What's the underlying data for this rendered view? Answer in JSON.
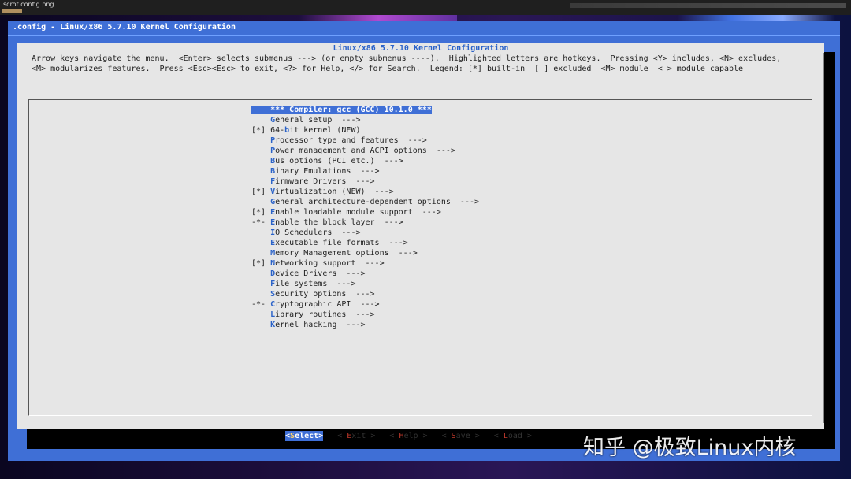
{
  "topbar": {
    "filename": "scrot config.png"
  },
  "window": {
    "title": ".config - Linux/x86 5.7.10 Kernel Configuration"
  },
  "dialog": {
    "title": "Linux/x86 5.7.10 Kernel Configuration",
    "help_line1": "Arrow keys navigate the menu.  <Enter> selects submenus ---> (or empty submenus ----).  Highlighted letters are hotkeys.  Pressing <Y> includes, <N> excludes,",
    "help_line2": "<M> modularizes features.  Press <Esc><Esc> to exit, <?> for Help, </> for Search.  Legend: [*] built-in  [ ] excluded  <M> module  < > module capable"
  },
  "menu": {
    "items": [
      {
        "prefix": "    ",
        "before": "",
        "hot": "",
        "after": "*** Compiler: gcc (GCC) 10.1.0 ***",
        "selected": true
      },
      {
        "prefix": "    ",
        "before": "",
        "hot": "G",
        "after": "eneral setup  --->"
      },
      {
        "prefix": "[*] ",
        "before": "64-",
        "hot": "b",
        "after": "it kernel (NEW)"
      },
      {
        "prefix": "    ",
        "before": "",
        "hot": "P",
        "after": "rocessor type and features  --->"
      },
      {
        "prefix": "    ",
        "before": "",
        "hot": "P",
        "after": "ower management and ACPI options  --->"
      },
      {
        "prefix": "    ",
        "before": "",
        "hot": "B",
        "after": "us options (PCI etc.)  --->"
      },
      {
        "prefix": "    ",
        "before": "",
        "hot": "B",
        "after": "inary Emulations  --->"
      },
      {
        "prefix": "    ",
        "before": "",
        "hot": "F",
        "after": "irmware Drivers  --->"
      },
      {
        "prefix": "[*] ",
        "before": "",
        "hot": "V",
        "after": "irtualization (NEW)  --->"
      },
      {
        "prefix": "    ",
        "before": "",
        "hot": "G",
        "after": "eneral architecture-dependent options  --->"
      },
      {
        "prefix": "[*] ",
        "before": "",
        "hot": "E",
        "after": "nable loadable module support  --->"
      },
      {
        "prefix": "-*- ",
        "before": "",
        "hot": "E",
        "after": "nable the block layer  --->"
      },
      {
        "prefix": "    ",
        "before": "",
        "hot": "I",
        "after": "O Schedulers  --->"
      },
      {
        "prefix": "    ",
        "before": "",
        "hot": "E",
        "after": "xecutable file formats  --->"
      },
      {
        "prefix": "    ",
        "before": "",
        "hot": "M",
        "after": "emory Management options  --->"
      },
      {
        "prefix": "[*] ",
        "before": "",
        "hot": "N",
        "after": "etworking support  --->"
      },
      {
        "prefix": "    ",
        "before": "",
        "hot": "D",
        "after": "evice Drivers  --->"
      },
      {
        "prefix": "    ",
        "before": "",
        "hot": "F",
        "after": "ile systems  --->"
      },
      {
        "prefix": "    ",
        "before": "",
        "hot": "S",
        "after": "ecurity options  --->"
      },
      {
        "prefix": "-*- ",
        "before": "",
        "hot": "C",
        "after": "ryptographic API  --->"
      },
      {
        "prefix": "    ",
        "before": "",
        "hot": "L",
        "after": "ibrary routines  --->"
      },
      {
        "prefix": "    ",
        "before": "",
        "hot": "K",
        "after": "ernel hacking  --->"
      }
    ]
  },
  "buttons": [
    {
      "open": "<",
      "key": "S",
      "rest": "elect",
      "close": ">",
      "selected": true
    },
    {
      "open": "< ",
      "key": "E",
      "rest": "xit",
      "close": " >"
    },
    {
      "open": "< ",
      "key": "H",
      "rest": "elp",
      "close": " >"
    },
    {
      "open": "< ",
      "key": "S",
      "rest": "ave",
      "close": " >"
    },
    {
      "open": "< ",
      "key": "L",
      "rest": "oad",
      "close": " >"
    }
  ],
  "watermark": "知乎 @极致Linux内核"
}
